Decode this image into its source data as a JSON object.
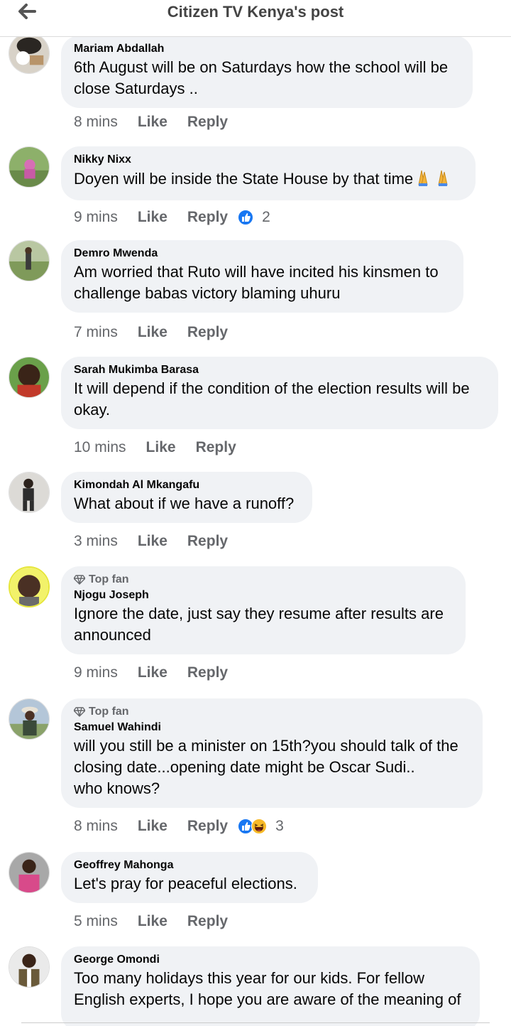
{
  "header": {
    "title": "Citizen TV Kenya's post",
    "back_icon": "arrow-left-icon"
  },
  "actions": {
    "like": "Like",
    "reply": "Reply"
  },
  "comments": [
    {
      "name": "Mariam Abdallah",
      "lines": [
        "6th August will be on Saturdays how the school will be",
        "close Saturdays .."
      ],
      "time": "8 mins"
    },
    {
      "name": "Nikky Nixx",
      "lines": [
        "Doyen will be inside the State House by that time"
      ],
      "emoji": "folded-hands x2",
      "time": "9 mins",
      "reactions": "2"
    },
    {
      "name": "Demro Mwenda",
      "lines": [
        "Am worried that Ruto will have incited his kinsmen to",
        "challenge babas victory blaming uhuru"
      ],
      "time": "7 mins"
    },
    {
      "name": "Sarah Mukimba Barasa",
      "lines": [
        "It will depend if the condition of the election results will be",
        "okay."
      ],
      "time": "10 mins"
    },
    {
      "name": "Kimondah Al Mkangafu",
      "lines": [
        "What about if we have a runoff?"
      ],
      "time": "3 mins"
    },
    {
      "badge": "Top fan",
      "name": "Njogu Joseph",
      "lines": [
        "Ignore the date, just say they resume after results are",
        "announced"
      ],
      "time": "9 mins"
    },
    {
      "badge": "Top fan",
      "name": "Samuel Wahindi",
      "lines": [
        "will you still be a minister on 15th?you should talk of the",
        "closing date...opening date might be Oscar Sudi..",
        "who knows?"
      ],
      "time": "8 mins",
      "reactions": "3"
    },
    {
      "name": "Geoffrey Mahonga",
      "lines": [
        "Let's pray for peaceful elections."
      ],
      "time": "5 mins"
    },
    {
      "name": "George Omondi",
      "lines": [
        "Too many holidays this year for our kids. For fellow",
        "English experts, I hope you are aware of the meaning of"
      ]
    }
  ],
  "colors": {
    "bubble": "#f0f2f5",
    "meta": "#65676b",
    "like_blue": "#1877f2",
    "haha_yellow": "#f7b928"
  }
}
